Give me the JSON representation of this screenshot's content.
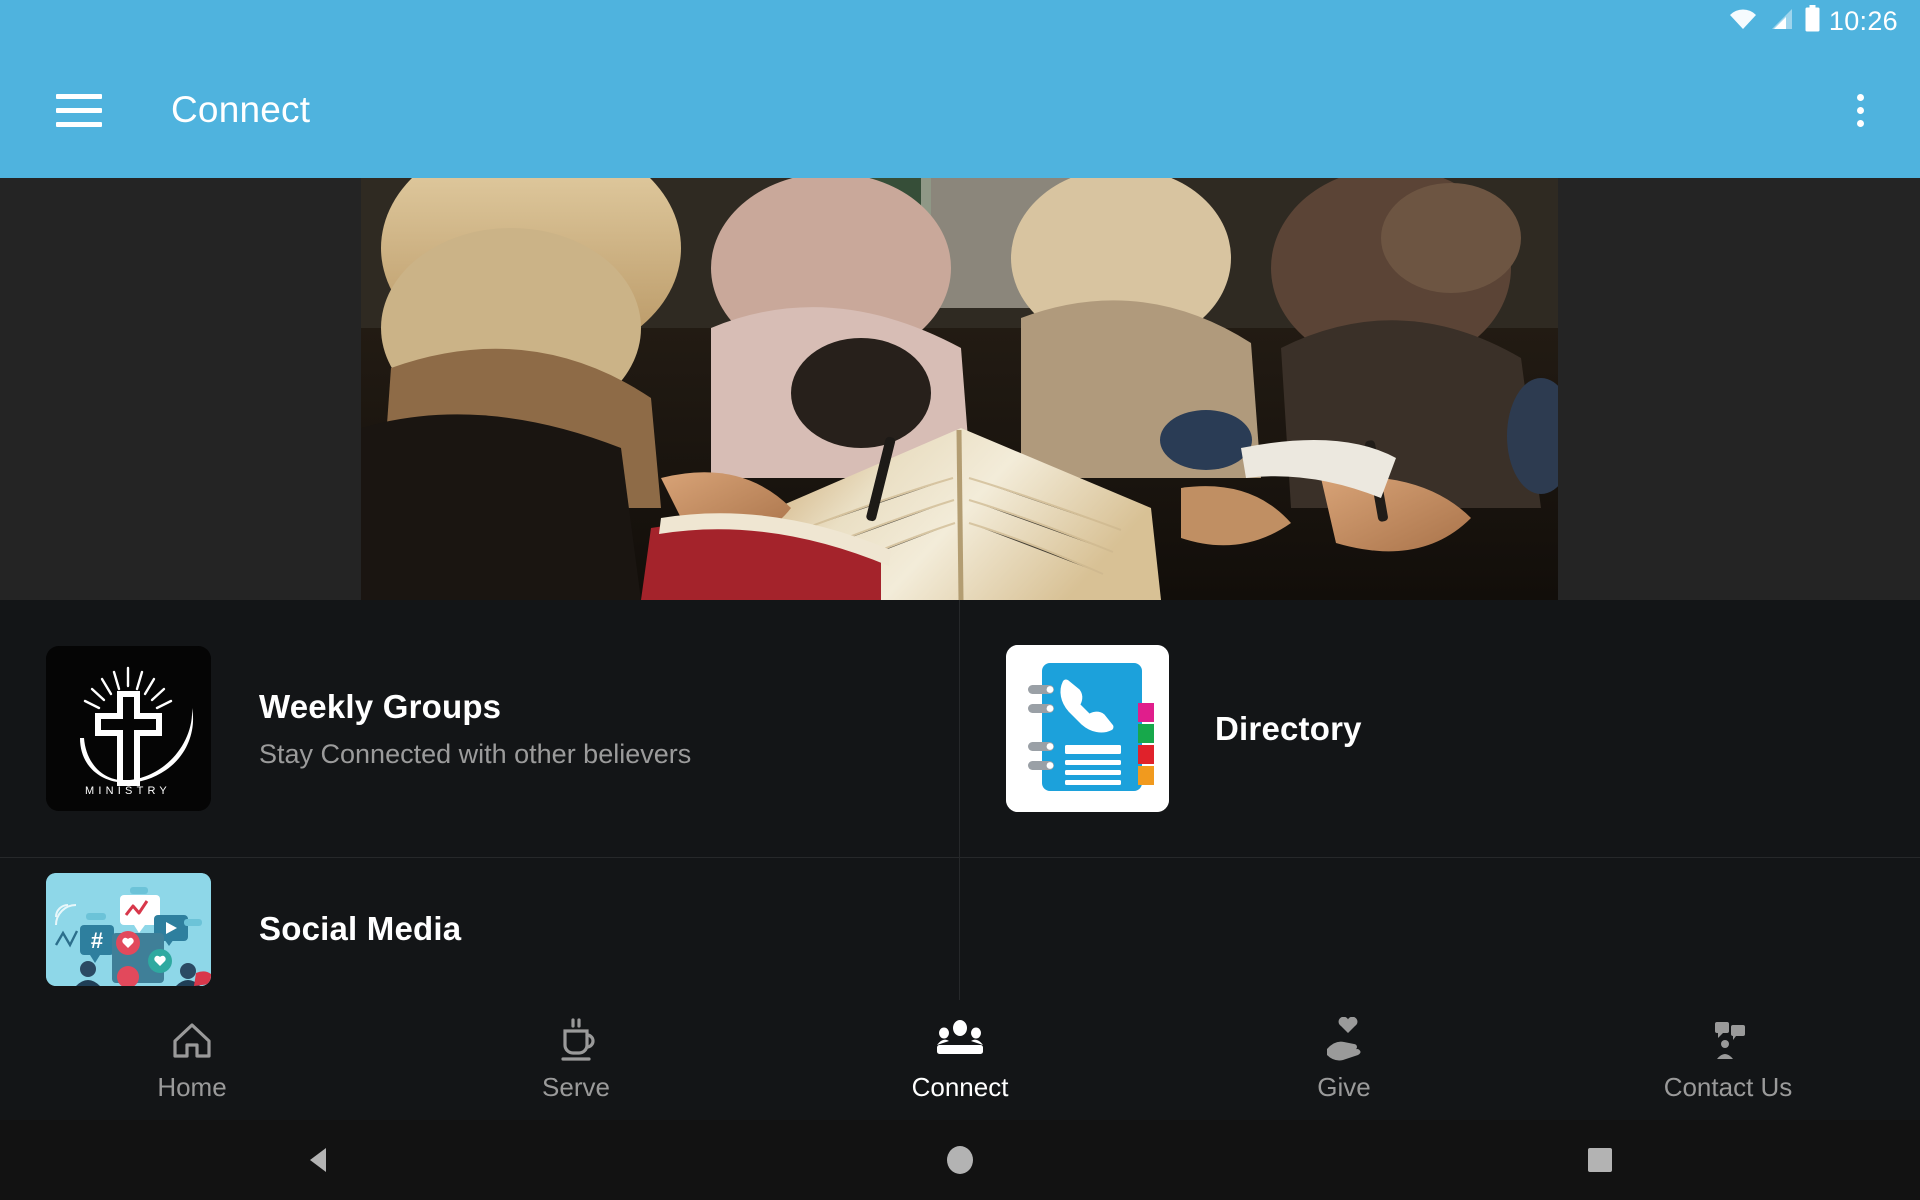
{
  "status_bar": {
    "time": "10:26",
    "icons": [
      "wifi-icon",
      "cell-signal-icon",
      "battery-icon"
    ]
  },
  "app_bar": {
    "title": "Connect",
    "menu_icon": "hamburger-menu-icon",
    "overflow_icon": "overflow-menu-icon",
    "background_color": "#4FB3DE"
  },
  "hero": {
    "alt": "group of people studying an open book together",
    "background_color": "#242424"
  },
  "cards": [
    {
      "title": "Weekly Groups",
      "subtitle": "Stay Connected with other believers",
      "icon": "ministry-cross-logo-icon",
      "icon_caption": "MINISTRY"
    },
    {
      "title": "Directory",
      "subtitle": "",
      "icon": "phone-directory-book-icon"
    },
    {
      "title": "Social Media",
      "subtitle": "",
      "icon": "social-media-illustration-icon"
    }
  ],
  "tab_bar": {
    "items": [
      {
        "label": "Home",
        "icon": "home-icon",
        "active": false
      },
      {
        "label": "Serve",
        "icon": "coffee-cup-icon",
        "active": false
      },
      {
        "label": "Connect",
        "icon": "people-group-icon",
        "active": true
      },
      {
        "label": "Give",
        "icon": "hand-heart-icon",
        "active": false
      },
      {
        "label": "Contact Us",
        "icon": "chat-person-icon",
        "active": false
      }
    ],
    "active_color": "#ffffff",
    "inactive_color": "#9a9a9a"
  },
  "system_nav": {
    "back": "back-triangle-icon",
    "home": "home-circle-icon",
    "recents": "recents-square-icon"
  },
  "colors": {
    "accent": "#4FB3DE",
    "card_background": "#131517",
    "hero_background": "#242424",
    "divider": "#26282a"
  }
}
